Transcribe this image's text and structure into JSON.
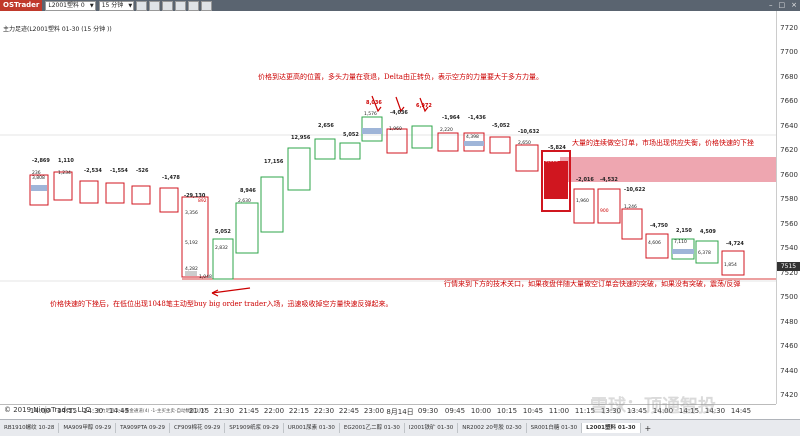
{
  "app": {
    "logo": "OSTrader"
  },
  "toolbar": {
    "instrument": "L2001塑料 0",
    "interval": "15 分钟"
  },
  "window_controls": [
    "–",
    "□",
    "×"
  ],
  "chart": {
    "title": "主力足迹(L2001塑料 01-30 (15 分钟 ))",
    "copyright": "© 2019 NinjaTrader, LLC",
    "footer_labels": "主力足迹 1-2-黄金通道(4) -1-主买主卖-自动数据 17/0",
    "current_price": "7515",
    "y_ticks": [
      "7720",
      "7700",
      "7680",
      "7660",
      "7640",
      "7620",
      "7600",
      "7580",
      "7560",
      "7540",
      "7520",
      "7500",
      "7480",
      "7460",
      "7440",
      "7420"
    ],
    "x_ticks": [
      "14:00",
      "14:15",
      "14:30",
      "14:45",
      "21:15",
      "21:30",
      "21:45",
      "22:00",
      "22:15",
      "22:30",
      "22:45",
      "23:00",
      "8月14日",
      "09:30",
      "09:45",
      "10:00",
      "10:15",
      "10:45",
      "11:00",
      "11:15",
      "13:30",
      "13:45",
      "14:00",
      "14:15",
      "14:30",
      "14:45"
    ],
    "deltas": [
      "-2,869",
      "1,110",
      "-2,534",
      "-1,554",
      "-526",
      "-1,478",
      "-29,130",
      "5,052",
      "8,946",
      "17,156",
      "12,956",
      "2,656",
      "5,052",
      "8,036",
      "-4,036",
      "6,972",
      "-1,964",
      "-1,436",
      "-5,052",
      "-10,632",
      "-5,824",
      "-2,016",
      "-4,532",
      "-10,622",
      "-4,750",
      "2,150",
      "4,509",
      "-4,724"
    ],
    "annotations": {
      "top": "价格到达更高的位置，多头力量在衰退，Delta由正转负，表示空方的力量要大于多方力量。",
      "right": "大量的连续做空订单，市场出现供应失衡，价格快速的下挫",
      "bottom_right": "行情来到下方的技术关口，如果夜盘伴随大量做空订单会快速的突破，如果没有突破，震荡/反弹",
      "bottom_left": "价格快速的下挫后，在低位出现1048笔主动型buy big order trader入场，迅速吸收掉空方量快速反弹起来。"
    },
    "footprint_samples": [
      "236",
      "3,808",
      "1,234",
      "1,048",
      "892",
      "3,356",
      "4,282",
      "2,832",
      "5,192",
      "2,630",
      "1,576",
      "1,960",
      "2,220",
      "4,398",
      "5,014",
      "2,650",
      "1,246",
      "4,606",
      "7,110",
      "6,378",
      "1,854",
      "900",
      "1,960"
    ]
  },
  "tabs": [
    "RB1910螺纹 10-28",
    "MA909甲醇 09-29",
    "TA909PTA 09-29",
    "CF909棉花 09-29",
    "SP1909纸浆 09-29",
    "UR001尿素 01-30",
    "EG2001乙二醇 01-30",
    "I2001铁矿 01-30",
    "NR2002 20号胶 02-30",
    "SR001白糖 01-30",
    "L2001塑料 01-30"
  ],
  "active_tab": "L2001塑料 01-30",
  "watermark": "雪球：顶通智投",
  "colors": {
    "green": "#2ea64a",
    "red": "#d0161f",
    "pink_zone": "#eea6b0",
    "annotation": "#c00000"
  }
}
